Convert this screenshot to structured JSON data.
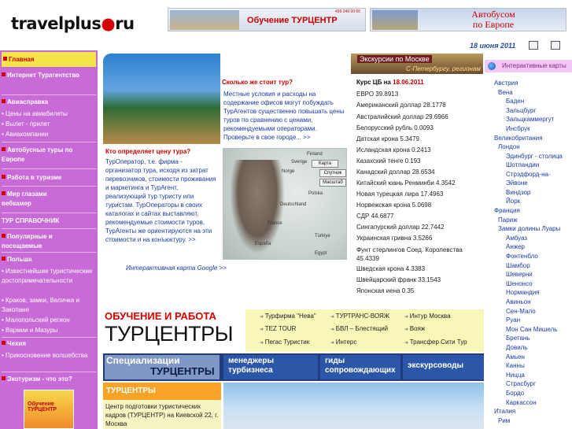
{
  "header": {
    "logo": "travelplus.ru",
    "banner1": {
      "label": "Обучение  ТУРЦЕНТР",
      "phone": "499 249 00 65"
    },
    "banner2": {
      "line1": "Автобусом",
      "line2": "по Европе"
    },
    "date": "18 июня 2011"
  },
  "nav": {
    "items": [
      {
        "label": "Главная",
        "bold": true
      },
      {
        "label": "Интернет Турагентство",
        "bold": true
      },
      {
        "label": "Авиасправка",
        "bold": true
      },
      {
        "label": "• Цены на авиабилеты"
      },
      {
        "label": "• Вылет - прилет"
      },
      {
        "label": "• Авиакомпании"
      },
      {
        "label": "Автобусные туры по Европе",
        "bold": true
      },
      {
        "label": "Работа в туризме",
        "bold": true
      },
      {
        "label": "Мир глазами вебкамер",
        "bold": true
      },
      {
        "label": "ТУР СПРАВОЧНИК",
        "bold": true
      },
      {
        "label": "Популярные и посещаемые",
        "bold": true
      },
      {
        "label": "Польша",
        "bold": true
      },
      {
        "label": "• Известнейшие туристические достопримечательности"
      },
      {
        "label": "• Краков, замки, Величка и Закопане"
      },
      {
        "label": "• Малопольский регион"
      },
      {
        "label": "• Вармии и Мазуры"
      },
      {
        "label": "Чехия",
        "bold": true
      },
      {
        "label": "• Прикосновение волшебства"
      },
      {
        "label": "Экотуризм - что это?",
        "bold": true
      }
    ],
    "promo": "Обучение ТУРЦЕНТР"
  },
  "main": {
    "question1": "Кто определяет цену тура?",
    "text1": "ТурОператор, т.е. фирма - организатор тура, исходя из затрат перевозчиков, стоимости проживания и маркетинга и ТурАгент, реализующий тур туристу или туристам. ТурОператоры в своих каталогах и сайтах выставляют, рекомендуемые стоимости туров, ТурАгенты же ориентируются на эти стоимости и на конъюктуру. >>",
    "google_link": "Интерактивная карта Google >>",
    "question2": "Сколько же стоит тур?",
    "text2": "Местные условия и расходы на содержание офисов могут побуждать ТурАгентов существенно повышать цены туров по сравнению с ценами, рекомендуемыми операторами. Проверьте в свое городе... >>",
    "map_buttons": [
      "Карта",
      "Спутник",
      "Масштаб"
    ],
    "map_labels": [
      "Finland",
      "Sverige",
      "Norge",
      "Deutschland",
      "Polska",
      "France",
      "España",
      "Türkiye",
      "Egypt"
    ],
    "moscow_banner": {
      "line1": "Экскурсии по Москве",
      "line2": "С-Петербургу, регионам"
    },
    "rates_title": "Курс ЦБ на",
    "rates_date": "18.06.2011",
    "rates": [
      "ЕВРО 39.8913",
      "Американский доллар 28.1778",
      "Австралийский доллар 29.6966",
      "Белорусский рубль 0.0093",
      "Датская крона 5.3479",
      "Исландская крона 0.2413",
      "Казахский тенге 0.193",
      "Канадский доллар 28.6534",
      "Китайский юань Ренминби 4.3542",
      "Новая турецкая лира 17.4963",
      "Норвежская крона 5.0698",
      "СДР 44.6877",
      "Сингапурский доллар 22.7442",
      "Украинская гривна 3.5266",
      "Фунт стерлингов Соед. Королевства 45.4339",
      "Шведская крона 4.3383",
      "Швейцарский франк 33.1543",
      "Японская иена 0.35"
    ],
    "edu_heading": "ОБУЧЕНИЕ И РАБОТА",
    "edu_big": "ТУРЦЕНТРЫ",
    "links": [
      "Турфирма \"Нева\"",
      "ТУРТРАНС-ВОЯЖ",
      "Интур Москва",
      "TEZ TOUR",
      "БВЛ – Блестящий",
      "Вояж",
      "Пегас Туристик",
      "Интерс",
      "Трансфер Сити Тур"
    ],
    "spec_a": "Специализации",
    "spec_b": "ТУРЦЕНТРЫ",
    "tabs": [
      "менеджеры турбизнеса",
      "гиды сопровождающих",
      "экскурсоводы"
    ],
    "turc_title": "ТУРЦЕНТРЫ",
    "turc_text": "Центр подготовки туристических кадров (ТУРЦЕНТР) на Киевской 22, г. Москва"
  },
  "right": {
    "maps_title": "Интерактивные карты",
    "items": [
      {
        "label": "Австрия",
        "level": 0
      },
      {
        "label": "Вена",
        "level": 1
      },
      {
        "label": "Баден",
        "level": 2
      },
      {
        "label": "Зальцбург",
        "level": 2
      },
      {
        "label": "Зальцкаммергут",
        "level": 2
      },
      {
        "label": "Инсбрук",
        "level": 2
      },
      {
        "label": "Великобритания",
        "level": 0
      },
      {
        "label": "Лондон",
        "level": 1
      },
      {
        "label": "Эдинбург - столица Шотландии",
        "level": 2
      },
      {
        "label": "Стрэдфорд-на-Эйвоне",
        "level": 2
      },
      {
        "label": "Виндзор",
        "level": 2
      },
      {
        "label": "Йорк",
        "level": 2
      },
      {
        "label": "Франция",
        "level": 0
      },
      {
        "label": "Париж",
        "level": 1
      },
      {
        "label": "Замки долины Луары",
        "level": 1
      },
      {
        "label": "Амбуаз",
        "level": 2
      },
      {
        "label": "Анжер",
        "level": 2
      },
      {
        "label": "Фонтенбло",
        "level": 2
      },
      {
        "label": "Шамбор",
        "level": 2
      },
      {
        "label": "Шеверни",
        "level": 2
      },
      {
        "label": "Шенонсо",
        "level": 2
      },
      {
        "label": "Нормандия",
        "level": 2
      },
      {
        "label": "Авиньон",
        "level": 2
      },
      {
        "label": "Сен-Мало",
        "level": 2
      },
      {
        "label": "Руан",
        "level": 2
      },
      {
        "label": "Мон Сан Мишель",
        "level": 2
      },
      {
        "label": "Бретань",
        "level": 2
      },
      {
        "label": "Довиль",
        "level": 2
      },
      {
        "label": "Амьен",
        "level": 2
      },
      {
        "label": "Канны",
        "level": 2
      },
      {
        "label": "Ницца",
        "level": 2
      },
      {
        "label": "Страсбург",
        "level": 2
      },
      {
        "label": "Бордо",
        "level": 2
      },
      {
        "label": "Каркассон",
        "level": 2
      },
      {
        "label": "Италия",
        "level": 0
      },
      {
        "label": "Рим",
        "level": 1
      }
    ]
  }
}
